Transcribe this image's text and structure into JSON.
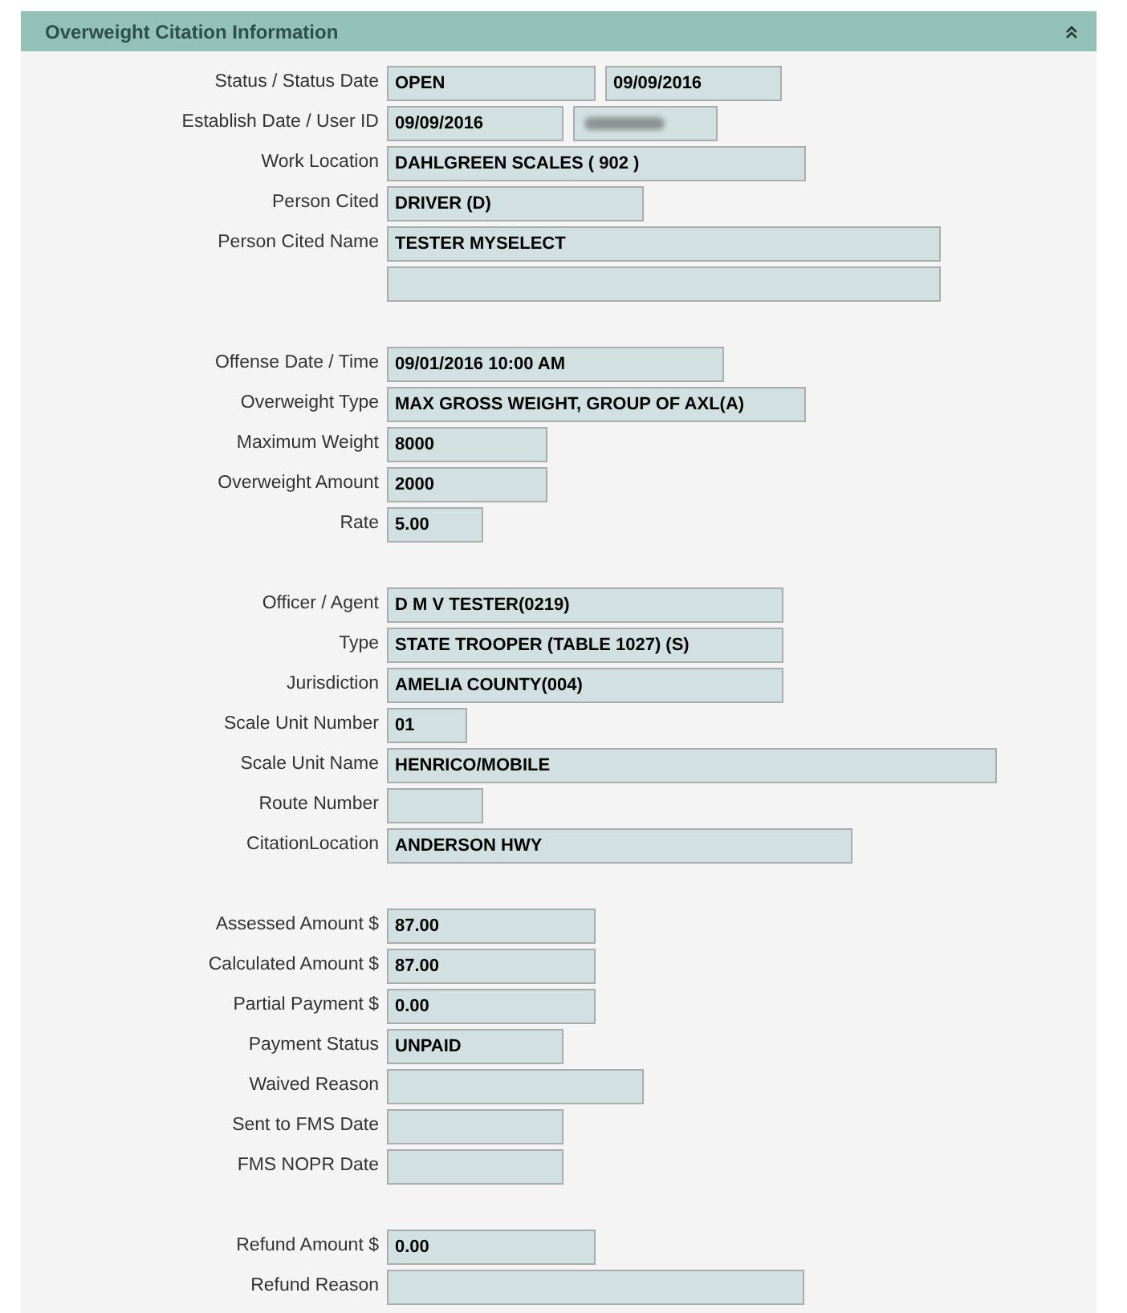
{
  "panel": {
    "title": "Overweight Citation Information"
  },
  "groups": [
    {
      "rows": [
        {
          "label": "Status / Status Date",
          "fields": [
            {
              "kind": "text",
              "value": "OPEN"
            },
            {
              "kind": "text",
              "value": "09/09/2016"
            }
          ]
        },
        {
          "label": "Establish Date / User ID",
          "fields": [
            {
              "kind": "text",
              "value": "09/09/2016"
            },
            {
              "kind": "redacted"
            }
          ]
        },
        {
          "label": "Work Location",
          "fields": [
            {
              "kind": "text",
              "value": "DAHLGREEN SCALES ( 902 )"
            }
          ]
        },
        {
          "label": "Person Cited",
          "fields": [
            {
              "kind": "text",
              "value": "DRIVER (D)"
            }
          ]
        },
        {
          "label": "Person Cited Name",
          "fields": [
            {
              "kind": "text",
              "value": "TESTER MYSELECT"
            }
          ]
        },
        {
          "fields": [
            {
              "kind": "blank"
            }
          ]
        }
      ]
    },
    {
      "rows": [
        {
          "label": "Offense Date / Time",
          "fields": [
            {
              "kind": "text",
              "value": "09/01/2016 10:00 AM"
            }
          ]
        },
        {
          "label": "Overweight Type",
          "fields": [
            {
              "kind": "text",
              "value": "MAX GROSS WEIGHT, GROUP OF AXL(A)"
            }
          ]
        },
        {
          "label": "Maximum Weight",
          "fields": [
            {
              "kind": "text",
              "value": "8000"
            }
          ]
        },
        {
          "label": "Overweight Amount",
          "fields": [
            {
              "kind": "text",
              "value": "2000"
            }
          ]
        },
        {
          "label": "Rate",
          "fields": [
            {
              "kind": "text",
              "value": "5.00"
            }
          ]
        }
      ]
    },
    {
      "rows": [
        {
          "label": "Officer / Agent",
          "fields": [
            {
              "kind": "text",
              "value": "D M V TESTER(0219)"
            }
          ]
        },
        {
          "label": "Type",
          "fields": [
            {
              "kind": "text",
              "value": "STATE TROOPER (TABLE 1027) (S)"
            }
          ]
        },
        {
          "label": "Jurisdiction",
          "fields": [
            {
              "kind": "text",
              "value": "AMELIA COUNTY(004)"
            }
          ]
        },
        {
          "label": "Scale Unit Number",
          "fields": [
            {
              "kind": "text",
              "value": "01"
            }
          ]
        },
        {
          "label": "Scale Unit Name",
          "fields": [
            {
              "kind": "text",
              "value": "HENRICO/MOBILE"
            }
          ]
        },
        {
          "label": "Route Number",
          "fields": [
            {
              "kind": "blank"
            }
          ]
        },
        {
          "label": "CitationLocation",
          "fields": [
            {
              "kind": "text",
              "value": "ANDERSON HWY"
            }
          ]
        }
      ]
    },
    {
      "rows": [
        {
          "label": "Assessed Amount $",
          "fields": [
            {
              "kind": "text",
              "value": "87.00"
            }
          ]
        },
        {
          "label": "Calculated Amount $",
          "fields": [
            {
              "kind": "text",
              "value": "87.00"
            }
          ]
        },
        {
          "label": "Partial Payment $",
          "fields": [
            {
              "kind": "text",
              "value": "0.00"
            }
          ]
        },
        {
          "label": "Payment Status",
          "fields": [
            {
              "kind": "text",
              "value": "UNPAID"
            }
          ]
        },
        {
          "label": "Waived Reason",
          "fields": [
            {
              "kind": "blank"
            }
          ]
        },
        {
          "label": "Sent to FMS Date",
          "fields": [
            {
              "kind": "blank"
            }
          ]
        },
        {
          "label": "FMS NOPR Date",
          "fields": [
            {
              "kind": "blank"
            }
          ]
        }
      ]
    },
    {
      "rows": [
        {
          "label": "Refund Amount $",
          "fields": [
            {
              "kind": "text",
              "value": "0.00"
            }
          ]
        },
        {
          "label": "Refund Reason",
          "fields": [
            {
              "kind": "blank"
            }
          ]
        }
      ]
    }
  ]
}
